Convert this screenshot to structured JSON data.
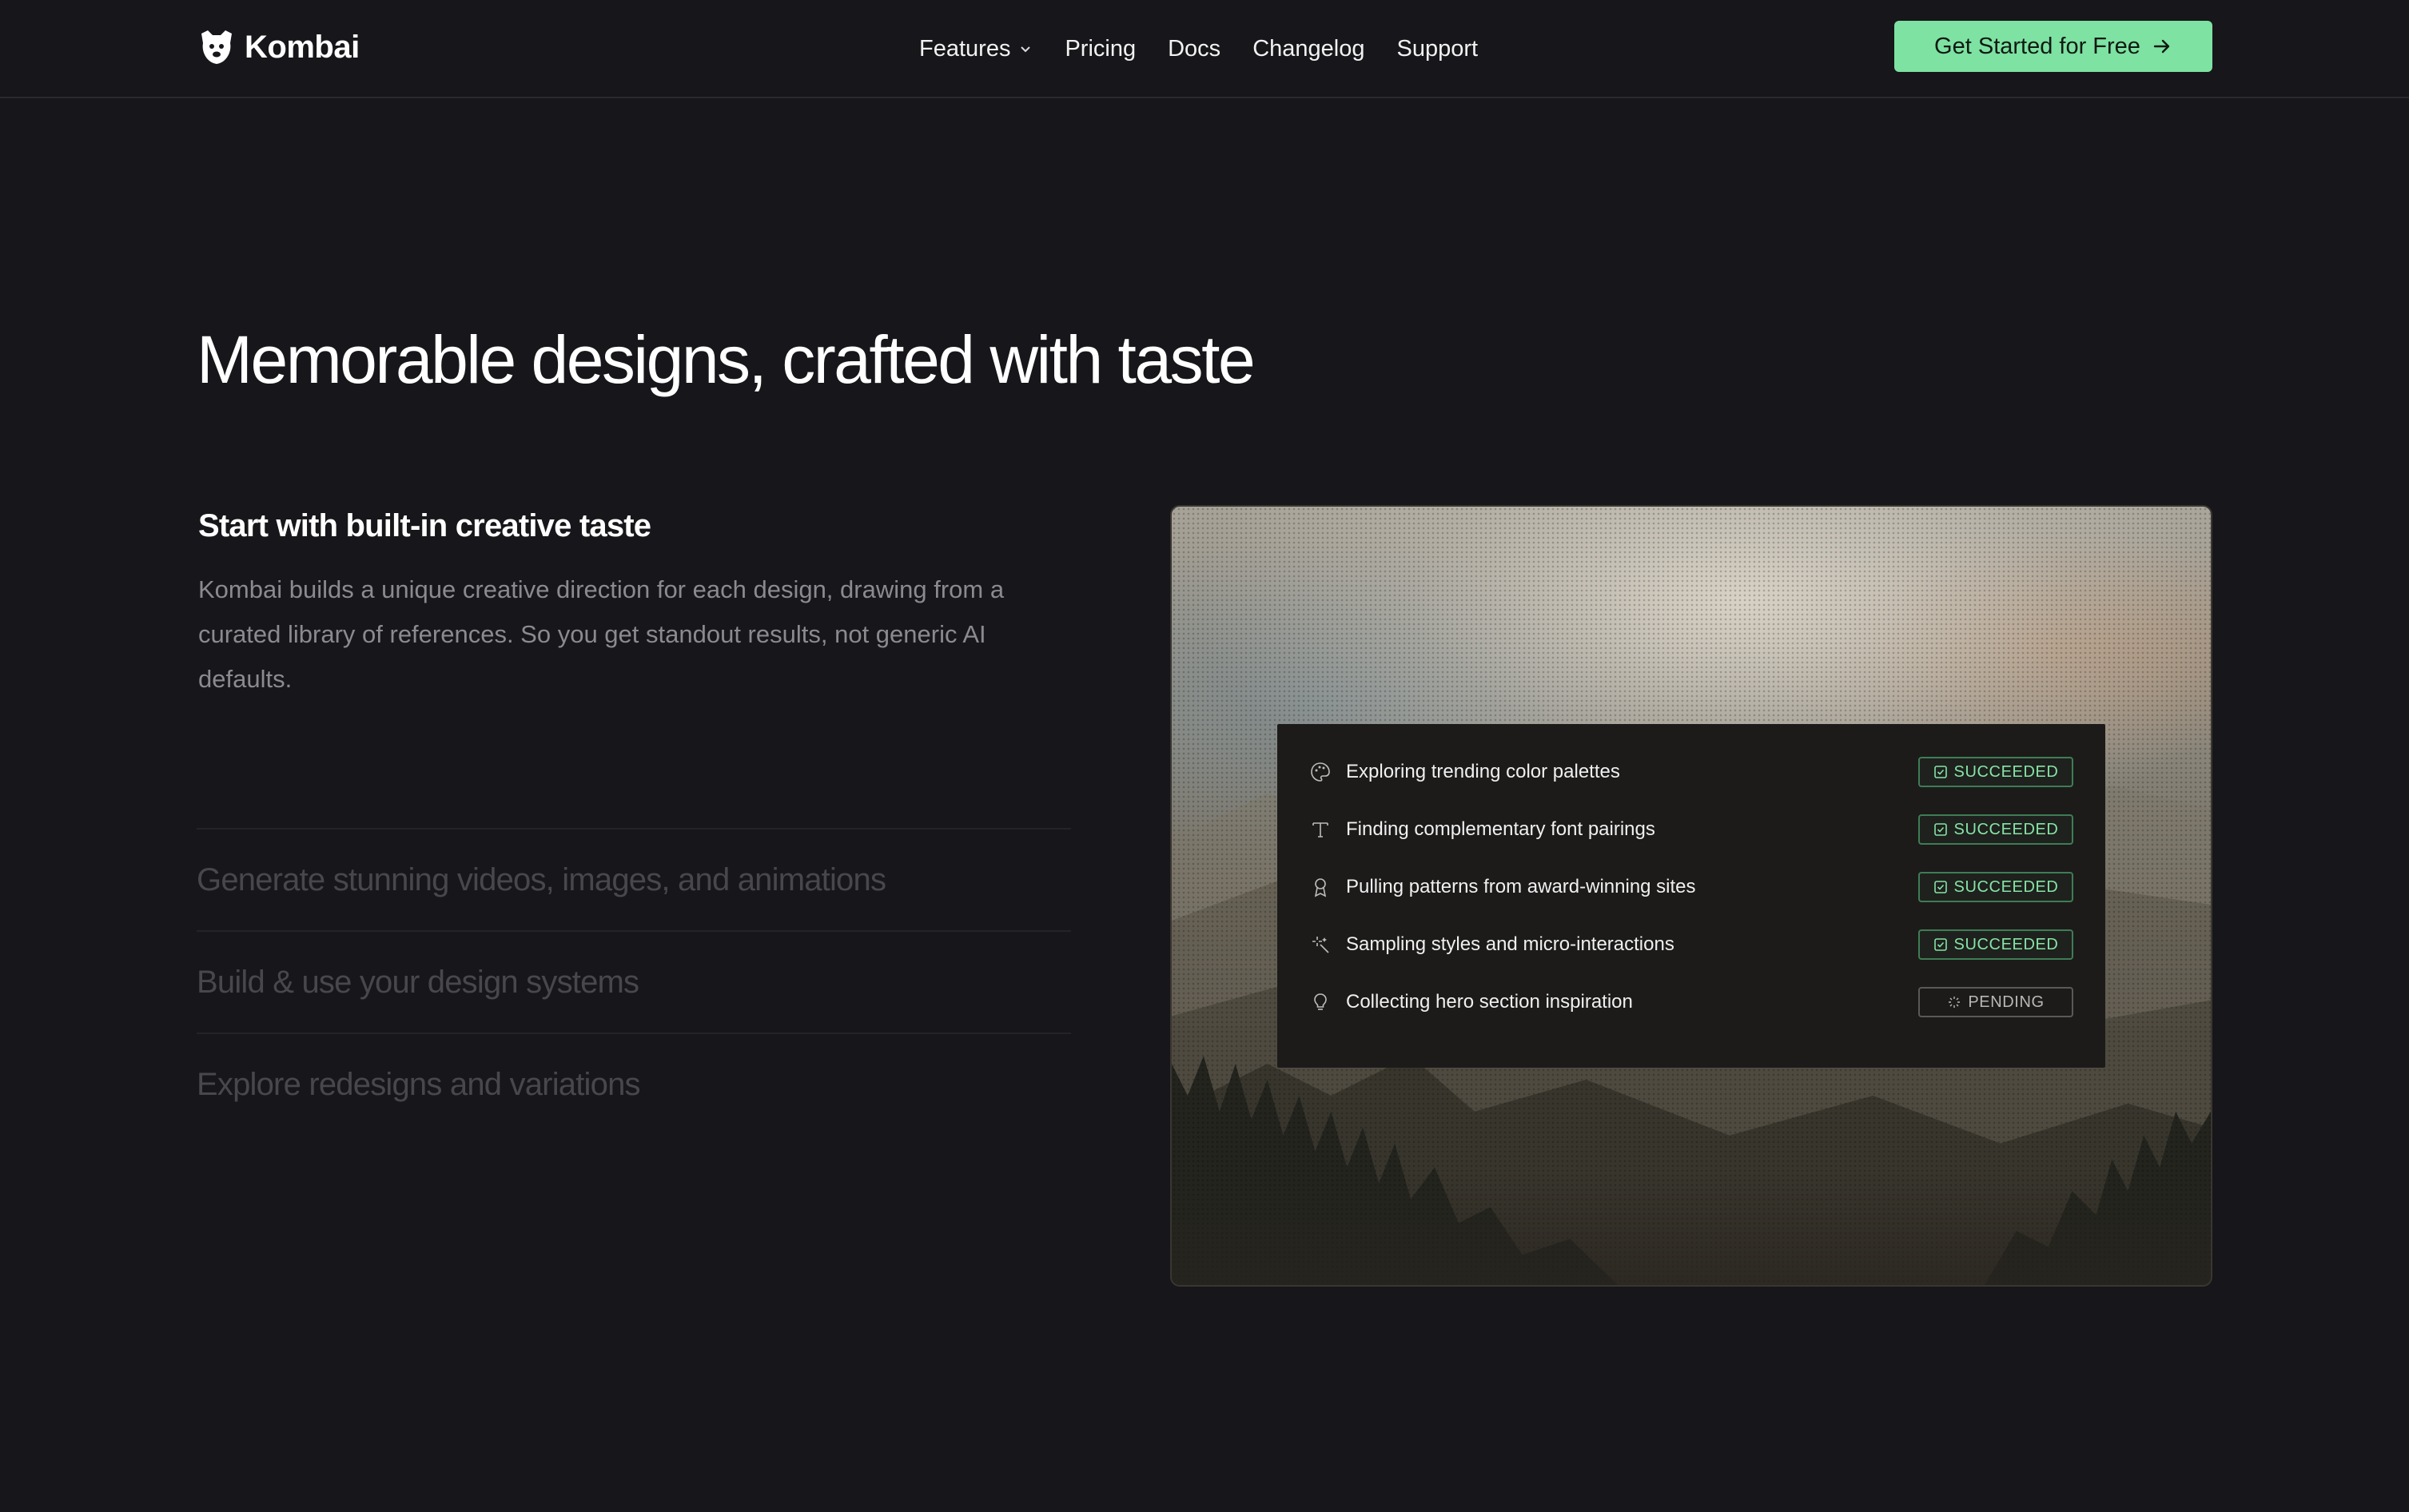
{
  "brand": {
    "name": "Kombai"
  },
  "nav": {
    "links": [
      {
        "label": "Features",
        "has_dropdown": true
      },
      {
        "label": "Pricing"
      },
      {
        "label": "Docs"
      },
      {
        "label": "Changelog"
      },
      {
        "label": "Support"
      }
    ],
    "cta_label": "Get Started for Free"
  },
  "hero": {
    "headline": "Memorable designs, crafted with taste",
    "active_feature": {
      "title": "Start with built-in creative taste",
      "description": "Kombai builds a unique creative direction for each design, drawing from a curated library of references. So you get standout results, not generic AI defaults."
    },
    "features": [
      "Generate stunning videos, images, and animations",
      "Build & use your design systems",
      "Explore redesigns and variations"
    ]
  },
  "tasks": [
    {
      "icon": "palette-icon",
      "label": "Exploring trending color palettes",
      "status": "SUCCEEDED"
    },
    {
      "icon": "type-icon",
      "label": "Finding complementary font pairings",
      "status": "SUCCEEDED"
    },
    {
      "icon": "award-icon",
      "label": "Pulling patterns from award-winning sites",
      "status": "SUCCEEDED"
    },
    {
      "icon": "sparkle-icon",
      "label": "Sampling styles and micro-interactions",
      "status": "SUCCEEDED"
    },
    {
      "icon": "lightbulb-icon",
      "label": "Collecting hero section inspiration",
      "status": "PENDING"
    }
  ],
  "colors": {
    "background": "#17161a",
    "accent": "#7ee2a2",
    "success": "#86e3a6",
    "muted_text": "#8b8a90"
  }
}
